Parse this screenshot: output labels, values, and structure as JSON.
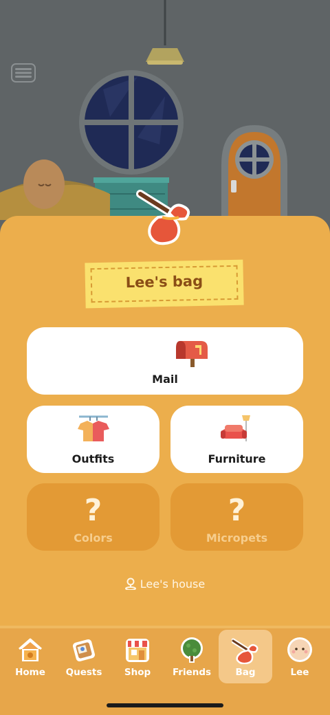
{
  "sheet": {
    "title": "Lee's bag"
  },
  "cards": {
    "mail": {
      "label": "Mail"
    },
    "outfits": {
      "label": "Outfits"
    },
    "furniture": {
      "label": "Furniture"
    },
    "colors": {
      "label": "Colors",
      "locked": true
    },
    "micropets": {
      "label": "Micropets",
      "locked": true
    }
  },
  "location": {
    "label": "Lee's house"
  },
  "tabbar": {
    "active": "Bag",
    "items": [
      {
        "label": "Home",
        "icon": "birdhouse-icon"
      },
      {
        "label": "Quests",
        "icon": "quest-board-icon"
      },
      {
        "label": "Shop",
        "icon": "shop-icon"
      },
      {
        "label": "Friends",
        "icon": "tree-icon"
      },
      {
        "label": "Bag",
        "icon": "bag-icon"
      },
      {
        "label": "Lee",
        "icon": "avatar-face-icon"
      }
    ]
  },
  "colors": {
    "sheet": "#ecae4c",
    "tag": "#fae16e",
    "locked_card": "#e39a35",
    "tabbar": "#e7a64a",
    "room_wall": "#5f6466"
  }
}
